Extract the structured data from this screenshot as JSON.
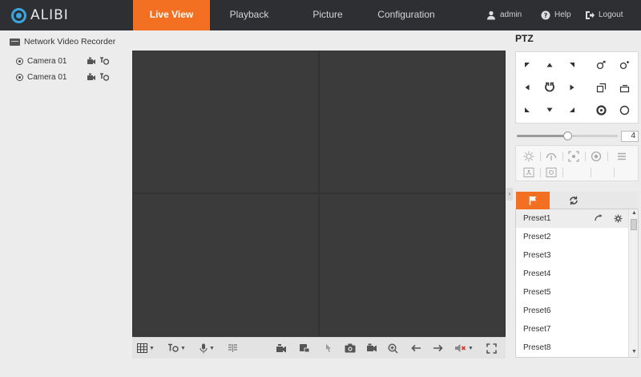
{
  "brand": {
    "name": "ALIBI"
  },
  "nav": {
    "tabs": [
      {
        "label": "Live View",
        "active": true
      },
      {
        "label": "Playback",
        "active": false
      },
      {
        "label": "Picture",
        "active": false
      },
      {
        "label": "Configuration",
        "active": false
      }
    ],
    "user": "admin",
    "help": "Help",
    "logout": "Logout"
  },
  "tree": {
    "root": "Network Video Recorder",
    "cameras": [
      {
        "label": "Camera 01"
      },
      {
        "label": "Camera 01"
      }
    ]
  },
  "ptz": {
    "title": "PTZ",
    "speed": "4",
    "speed_fraction": 0.5,
    "presets": [
      "Preset1",
      "Preset2",
      "Preset3",
      "Preset4",
      "Preset5",
      "Preset6",
      "Preset7",
      "Preset8"
    ],
    "selected_preset": "Preset1"
  },
  "colors": {
    "accent": "#f36f21",
    "topbar": "#2d2f33",
    "logo": "#39a6dd",
    "video_bg": "#333333"
  }
}
